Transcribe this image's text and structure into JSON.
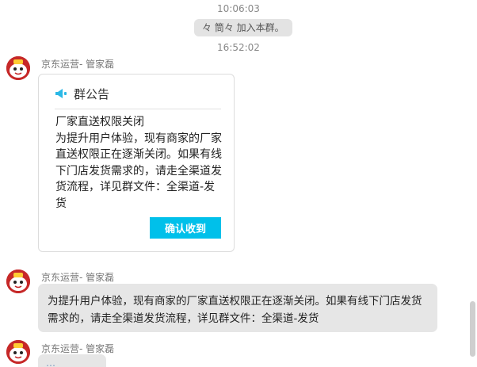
{
  "timestamps": [
    "10:06:03",
    "16:52:02"
  ],
  "system_message": "々 筒々 加入本群。",
  "sender_name": "京东运营- 管家磊",
  "notice": {
    "title": "群公告",
    "body": "厂家直送权限关闭\n为提升用户体验，现有商家的厂家直送权限正在逐渐关闭。如果有线下门店发货需求的，请走全渠道发货流程，详见群文件：全渠道-发货",
    "confirm_label": "确认收到"
  },
  "message_text": "为提升用户体验，现有商家的厂家直送权限正在逐渐关闭。如果有线下门店发货需求的，请走全渠道发货流程，详见群文件：全渠道-发货",
  "partial_message_text": "…",
  "colors": {
    "accent": "#00c0ea",
    "bubble": "#e6e6e6",
    "avatar": "#c62828"
  },
  "icons": {
    "avatar": "jd-mascot-avatar-icon",
    "notice": "megaphone-icon"
  }
}
